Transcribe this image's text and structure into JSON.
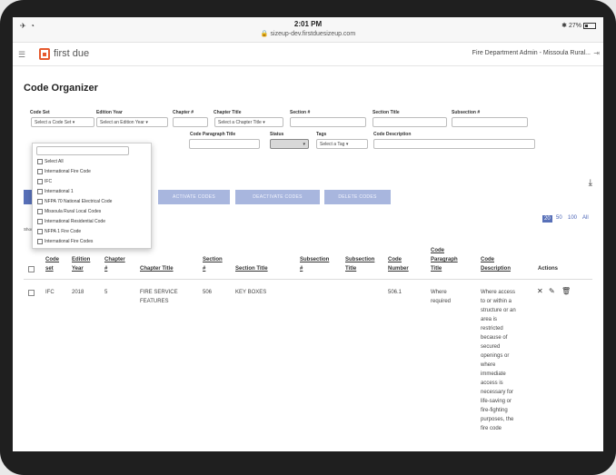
{
  "status_bar": {
    "time": "2:01 PM",
    "url": "sizeup-dev.firstduesizeup.com",
    "battery": "27%"
  },
  "app": {
    "logo_text": "first due",
    "department": "Fire Department Admin - Missoula Rural..."
  },
  "page": {
    "title": "Code Organizer"
  },
  "filters": {
    "code_set": {
      "label": "Code Set",
      "value": "Select a Code Set"
    },
    "edition_year": {
      "label": "Edition Year",
      "value": "Select an Edition Year"
    },
    "chapter_no": {
      "label": "Chapter #"
    },
    "chapter_title": {
      "label": "Chapter Title",
      "value": "Select a Chapter Title"
    },
    "section_no": {
      "label": "Section #"
    },
    "section_title": {
      "label": "Section Title"
    },
    "subsection_no": {
      "label": "Subsection #"
    },
    "code_paragraph_title": {
      "label": "Code Paragraph Title"
    },
    "status": {
      "label": "Status",
      "value": ""
    },
    "tags": {
      "label": "Tags",
      "value": "Select a Tag"
    },
    "code_description": {
      "label": "Code Description"
    }
  },
  "dropdown": {
    "items": [
      {
        "label": "Select All"
      },
      {
        "label": "International Fire Code"
      },
      {
        "label": "IFC"
      },
      {
        "label": "International 1"
      },
      {
        "label": "NFPA 70 National Electrical Code"
      },
      {
        "label": "Missoula Rural Local Codes"
      },
      {
        "label": "International Residential Code"
      },
      {
        "label": "NFPA 1 Fire Code"
      },
      {
        "label": "International Fire Codes"
      }
    ]
  },
  "actions": {
    "activate": "ACTIVATE CODES",
    "deactivate": "DEACTIVATE CODES",
    "delete": "DELETE CODES"
  },
  "pagination": {
    "showing": "Showing 1 to 1 of 1 entries",
    "sizes": [
      "20",
      "50",
      "100",
      "All"
    ],
    "active": "20"
  },
  "table": {
    "headers": {
      "code_set": [
        "Code",
        "set"
      ],
      "edition_year": [
        "Edition",
        "Year"
      ],
      "chapter_no": [
        "Chapter",
        "#"
      ],
      "chapter_title": "Chapter Title",
      "section_no": [
        "Section",
        "#"
      ],
      "section_title": "Section Title",
      "subsection_no": [
        "Subsection",
        "#"
      ],
      "subsection_title": [
        "Subsection",
        "Title"
      ],
      "code_number": [
        "Code",
        "Number"
      ],
      "code_paragraph_title": [
        "Code",
        "Paragraph",
        "Title"
      ],
      "code_description": [
        "Code",
        "Description"
      ],
      "actions": "Actions"
    },
    "rows": [
      {
        "code_set": "IFC",
        "edition_year": "2018",
        "chapter_no": "5",
        "chapter_title": [
          "FIRE SERVICE",
          "FEATURES"
        ],
        "section_no": "506",
        "section_title": "KEY BOXES",
        "subsection_no": "",
        "subsection_title": "",
        "code_number": "506.1",
        "code_paragraph_title": [
          "Where",
          "required"
        ],
        "code_description": [
          "Where access",
          "to or within a",
          "structure or an",
          "area is",
          "restricted",
          "because of",
          "secured",
          "openings or",
          "where",
          "immediate",
          "access is",
          "necessary for",
          "life-saving or",
          "fire-fighting",
          "purposes, the",
          "fire code"
        ]
      }
    ]
  }
}
